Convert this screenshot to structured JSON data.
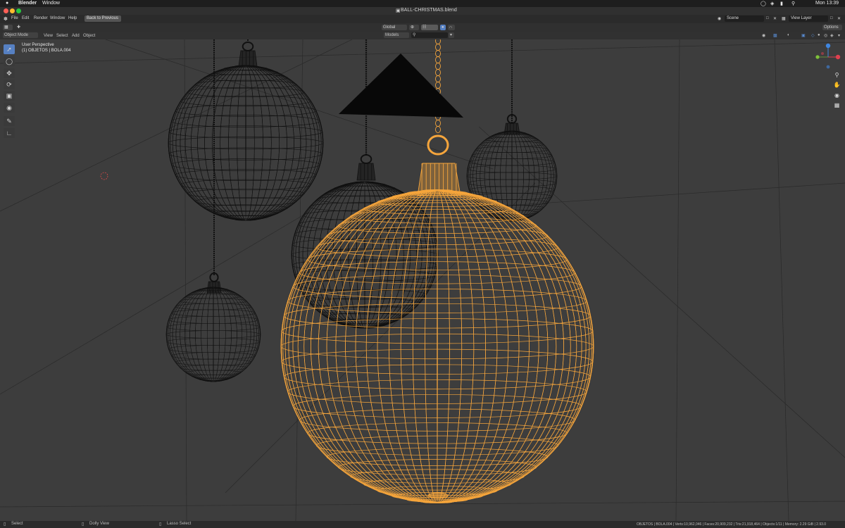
{
  "mac_menubar": {
    "apple": "",
    "app_name": "Blender",
    "menu_window": "Window",
    "clock": "Mon 13:39"
  },
  "window": {
    "title": "BALL-CHRISTMAS.blend"
  },
  "topbar": {
    "menus": [
      "File",
      "Edit",
      "Render",
      "Window",
      "Help"
    ],
    "back_button": "Back to Previous",
    "scene": "Scene",
    "view_layer": "View Layer"
  },
  "viewport_header": {
    "transform_orientation": "Global",
    "collection_filter": "Models",
    "search_placeholder": "",
    "options": "Options"
  },
  "tool_header": {
    "mode": "Object Mode",
    "menus": [
      "View",
      "Select",
      "Add",
      "Object"
    ]
  },
  "viewport": {
    "view_name": "User Perspective",
    "active_object": "(1) OBJETOS | BOLA.004",
    "wireframe_color_selected": "#f5a53c",
    "wireframe_color_unselected": "#111111",
    "background": "#3d3d3d"
  },
  "gizmo": {
    "x_label": "X",
    "y_label": "Y",
    "z_label": "Z",
    "x_color": "#e0404f",
    "y_color": "#7fc33a",
    "z_color": "#3f86e0"
  },
  "statusbar": {
    "left_hint": "Select",
    "middle_hint": "Dolly View",
    "right_hint": "Lasso Select",
    "stats": "OBJETOS | BOLA.004 | Verts:10,962,046 | Faces:20,909,232 | Tris:21,918,464 | Objects:1/11 | Memory: 2.29 GiB | 2.93.0"
  }
}
